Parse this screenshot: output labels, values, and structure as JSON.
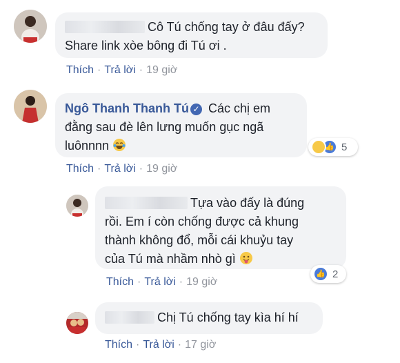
{
  "comments": [
    {
      "text_line1": "Cô Tú chống tay ở đâu đấy?",
      "text_line2": "Share link xòe bông đi Tú ơi .",
      "like": "Thích",
      "reply": "Trả lời",
      "time": "19 giờ"
    },
    {
      "author": "Ngô Thanh Thanh Tú",
      "text_line1": "Các chị em",
      "text_line2": "đằng sau đè lên lưng muốn gục ngã",
      "text_line3": "luônnnn",
      "reaction_count": "5",
      "like": "Thích",
      "reply": "Trả lời",
      "time": "19 giờ"
    },
    {
      "text_line1": "Tựa vào đấy là đúng",
      "text_line2": "rồi. Em í còn chống được cả khung",
      "text_line3": "thành không đổ, mỗi cái khuỷu tay",
      "text_line4": "của Tú mà nhầm nhò gì",
      "reaction_count": "2",
      "like": "Thích",
      "reply": "Trả lời",
      "time": "19 giờ"
    },
    {
      "text_line1": "Chị Tú chống tay kìa hí hí",
      "like": "Thích",
      "reply": "Trả lời",
      "time": "17 giờ"
    }
  ],
  "colors": {
    "link": "#385898",
    "bubble": "#f2f3f5",
    "meta": "#90949c",
    "like_blue": "#4a7bd9",
    "haha_yellow": "#f7c948"
  },
  "icons": [
    "verified-badge-icon",
    "crying-laughing-emoji-icon",
    "tongue-out-emoji-icon",
    "like-reaction-icon",
    "haha-reaction-icon"
  ]
}
